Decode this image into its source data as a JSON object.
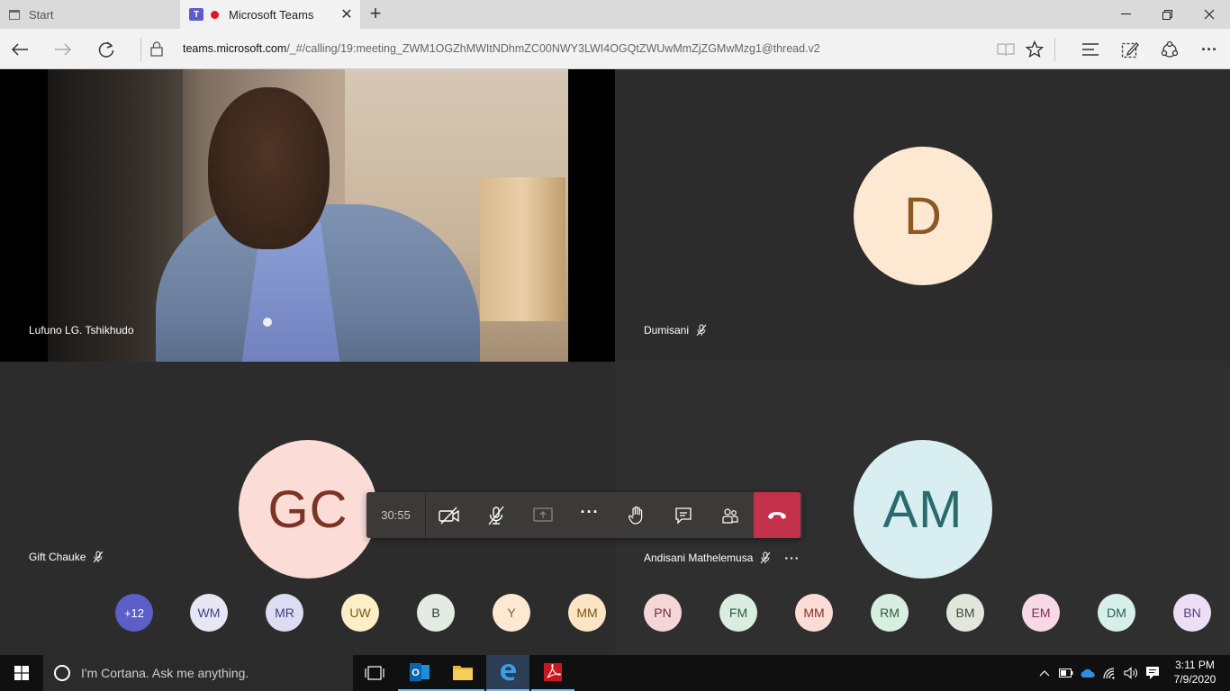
{
  "browser": {
    "tabs": [
      {
        "label": "Start"
      },
      {
        "label": "Microsoft Teams"
      }
    ],
    "url_domain": "teams.microsoft.com",
    "url_path": "/_#/calling/19:meeting_ZWM1OGZhMWItNDhmZC00NWY3LWI4OGQtZWUwMmZjZGMwMzg1@thread.v2"
  },
  "meeting": {
    "participants": [
      {
        "name": "Lufuno LG. Tshikhudo",
        "video": true
      },
      {
        "name": "Dumisani",
        "initials": "D",
        "muted": true
      },
      {
        "name": "Gift Chauke",
        "initials": "GC",
        "muted": true
      },
      {
        "name": "Andisani Mathelemusa",
        "initials": "AM",
        "muted": true
      }
    ],
    "timer": "30:55",
    "overflow_count": "+12",
    "strip": [
      {
        "initials": "WM",
        "bg": "#e6e6f5",
        "fg": "#3f3f7a"
      },
      {
        "initials": "MR",
        "bg": "#dcdcf2",
        "fg": "#3f3f7a"
      },
      {
        "initials": "UW",
        "bg": "#fbefc8",
        "fg": "#7a5a12"
      },
      {
        "initials": "B",
        "bg": "#e3ebe3",
        "fg": "#333333"
      },
      {
        "initials": "Y",
        "bg": "#fde9d2",
        "fg": "#8b5a24"
      },
      {
        "initials": "MM",
        "bg": "#fbe5c5",
        "fg": "#7a5412"
      },
      {
        "initials": "PN",
        "bg": "#f4d6d9",
        "fg": "#7a2a33"
      },
      {
        "initials": "FM",
        "bg": "#d9ede0",
        "fg": "#2d5d3a"
      },
      {
        "initials": "MM",
        "bg": "#fbdcd7",
        "fg": "#7d3325"
      },
      {
        "initials": "RM",
        "bg": "#d6efe0",
        "fg": "#2d5d3a"
      },
      {
        "initials": "BM",
        "bg": "#e2e6dd",
        "fg": "#3c4a33"
      },
      {
        "initials": "EM",
        "bg": "#f7d9e6",
        "fg": "#7a2a52"
      },
      {
        "initials": "DM",
        "bg": "#d6efe8",
        "fg": "#2d5d52"
      },
      {
        "initials": "BN",
        "bg": "#ecdef5",
        "fg": "#5a3a7a"
      }
    ],
    "colors": {
      "overflow_bg": "#5b5fc7",
      "hangup": "#c4314b"
    }
  },
  "taskbar": {
    "cortana_placeholder": "I'm Cortana. Ask me anything.",
    "time": "3:11 PM",
    "date": "7/9/2020"
  }
}
